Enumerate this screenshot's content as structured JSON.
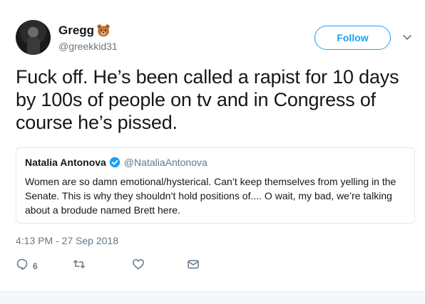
{
  "author": {
    "display_name": "Gregg",
    "name_emoji_icon": "bear-face-icon",
    "handle": "@greekkid31"
  },
  "follow_button": {
    "label": "Follow"
  },
  "tweet": {
    "text": "Fuck off. He’s been called a rapist for 10 days by 100s of people on tv and in Congress of course he’s pissed.",
    "timestamp": "4:13 PM - 27 Sep 2018"
  },
  "quoted_tweet": {
    "display_name": "Natalia Antonova",
    "handle": "@NataliaAntonova",
    "text": "Women are so damn emotional/hysterical. Can’t keep themselves from yelling in the Senate. This is why they shouldn’t hold positions of.... O wait, my bad, we’re talking about a brodude named Brett here."
  },
  "actions": {
    "reply_count": "6"
  },
  "colors": {
    "accent": "#1da1f2",
    "secondary_text": "#657786",
    "border": "#e1e8ed"
  }
}
